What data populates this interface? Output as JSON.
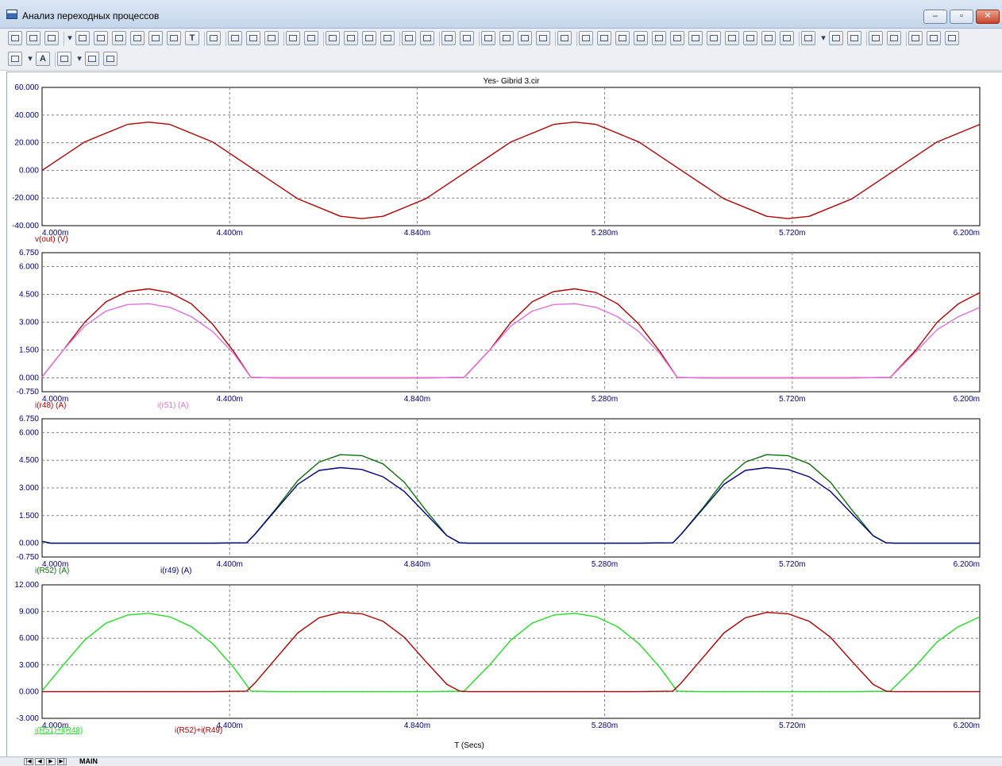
{
  "window": {
    "title": "Анализ переходных процессов",
    "minimize_label": "–",
    "restore_label": "▫",
    "close_label": "✕"
  },
  "toolbar1": {
    "text_tool_label": "T",
    "icons": [
      "select-arrow-icon",
      "pan-hand-icon",
      "scale-icon",
      "dropdown-icon",
      "zoom-window-icon",
      "scale-mode-icon",
      "cursor-mode-icon",
      "cursor-mode-2-icon",
      "data-point-icon",
      "graph-text-icon",
      "text-icon",
      "properties-icon",
      "run-icon",
      "stop-icon",
      "pause-icon",
      "scale-x-icon",
      "scale-y-icon",
      "grid-icon",
      "minor-grid-icon",
      "tokens-icon",
      "data-points-icon",
      "horizontal-axis-icon",
      "vertical-axis-icon",
      "stack-icon",
      "plot-icon",
      "zoom-out-icon",
      "zoom-in-icon",
      "zoom-fit-icon",
      "zoom-reset-icon",
      "label-branch-icon",
      "cursor-left-icon",
      "cursor-right-icon",
      "peak-icon",
      "valley-icon",
      "high-icon",
      "low-icon",
      "inflection-icon",
      "global-high-icon",
      "global-low-icon",
      "top-icon",
      "bottom-icon",
      "slope-icon",
      "copy-icon",
      "dropdown-icon",
      "list-icon",
      "numeric-output-icon",
      "stack-plots-icon",
      "fit-plots-icon",
      "zoom-plus-icon",
      "zoom-minus-icon",
      "zoom-100-icon"
    ]
  },
  "toolbar2": {
    "font_label": "A",
    "icons": [
      "grid-view-icon",
      "dropdown-icon",
      "font-icon",
      "color-icon",
      "dropdown-icon",
      "copy-plot-icon",
      "paste-plot-icon"
    ]
  },
  "plot_title": "Yes- Gibrid 3.cir",
  "x_axis_label": "T (Secs)",
  "colors": {
    "axis_text": "#000080",
    "grid": "#808080",
    "vout": "#b00000",
    "ir48": "#b00000",
    "ir51": "#e070e0",
    "iR52": "#0a6e0a",
    "ir49": "#00007f",
    "sum1": "#22dd22",
    "sum2": "#b00000"
  },
  "chart_data": [
    {
      "type": "line",
      "x_ticks": [
        "4.000m",
        "4.400m",
        "4.840m",
        "5.280m",
        "5.720m",
        "6.200m"
      ],
      "xlim": [
        4.0,
        6.2
      ],
      "x_units": "ms",
      "y_ticks": [
        "60.000",
        "40.000",
        "20.000",
        "0.000",
        "-20.000",
        "-40.000"
      ],
      "ylim": [
        -40,
        60
      ],
      "series": [
        {
          "name": "v(out) (V)",
          "x": [
            4.0,
            4.1,
            4.2,
            4.25,
            4.3,
            4.4,
            4.5,
            4.6,
            4.7,
            4.75,
            4.8,
            4.9,
            5.0,
            5.1,
            5.2,
            5.25,
            5.3,
            5.4,
            5.5,
            5.6,
            5.7,
            5.75,
            5.8,
            5.9,
            6.0,
            6.1,
            6.2
          ],
          "y": [
            0,
            20.6,
            33.2,
            34.9,
            33.2,
            20.6,
            0,
            -20.6,
            -33.2,
            -34.9,
            -33.2,
            -20.6,
            0,
            20.6,
            33.2,
            34.9,
            33.2,
            20.6,
            0,
            -20.6,
            -33.2,
            -34.9,
            -33.2,
            -20.6,
            0,
            20.6,
            33.2
          ]
        }
      ]
    },
    {
      "type": "line",
      "x_ticks": [
        "4.000m",
        "4.400m",
        "4.840m",
        "5.280m",
        "5.720m",
        "6.200m"
      ],
      "xlim": [
        4.0,
        6.2
      ],
      "y_ticks": [
        "6.750",
        "6.000",
        "4.500",
        "3.000",
        "1.500",
        "0.000",
        "-0.750"
      ],
      "ylim": [
        -0.75,
        6.75
      ],
      "series": [
        {
          "name": "i(r48) (A)",
          "x": [
            4.0,
            4.05,
            4.1,
            4.15,
            4.2,
            4.25,
            4.3,
            4.35,
            4.4,
            4.45,
            4.49,
            4.55,
            4.6,
            4.7,
            4.8,
            4.9,
            4.99,
            5.05,
            5.1,
            5.15,
            5.2,
            5.25,
            5.3,
            5.35,
            5.4,
            5.45,
            5.49,
            5.55,
            5.6,
            5.7,
            5.8,
            5.9,
            5.99,
            6.05,
            6.1,
            6.15,
            6.2
          ],
          "y": [
            0.05,
            1.5,
            3.0,
            4.1,
            4.65,
            4.8,
            4.6,
            4.0,
            2.9,
            1.4,
            0.02,
            0,
            0,
            0,
            0,
            0,
            0.02,
            1.5,
            3.0,
            4.1,
            4.65,
            4.8,
            4.6,
            4.0,
            2.9,
            1.4,
            0.02,
            0,
            0,
            0,
            0,
            0,
            0.02,
            1.5,
            3.0,
            4.0,
            4.6
          ]
        },
        {
          "name": "i(r51) (A)",
          "x": [
            4.0,
            4.05,
            4.1,
            4.15,
            4.2,
            4.25,
            4.3,
            4.35,
            4.4,
            4.45,
            4.49,
            4.55,
            4.6,
            4.7,
            4.8,
            4.9,
            4.99,
            5.05,
            5.1,
            5.15,
            5.2,
            5.25,
            5.3,
            5.35,
            5.4,
            5.45,
            5.49,
            5.55,
            5.6,
            5.7,
            5.8,
            5.9,
            5.99,
            6.05,
            6.1,
            6.15,
            6.2
          ],
          "y": [
            0.05,
            1.5,
            2.8,
            3.6,
            3.95,
            4.0,
            3.8,
            3.3,
            2.5,
            1.3,
            0.02,
            0,
            0,
            0,
            0,
            0,
            0.02,
            1.5,
            2.8,
            3.6,
            3.95,
            4.0,
            3.8,
            3.3,
            2.5,
            1.3,
            0.02,
            0,
            0,
            0,
            0,
            0,
            0.02,
            1.4,
            2.6,
            3.3,
            3.8
          ]
        }
      ]
    },
    {
      "type": "line",
      "x_ticks": [
        "4.000m",
        "4.400m",
        "4.840m",
        "5.280m",
        "5.720m",
        "6.200m"
      ],
      "xlim": [
        4.0,
        6.2
      ],
      "y_ticks": [
        "6.750",
        "6.000",
        "4.500",
        "3.000",
        "1.500",
        "0.000",
        "-0.750"
      ],
      "ylim": [
        -0.75,
        6.75
      ],
      "series": [
        {
          "name": "i(R52) (A)",
          "x": [
            4.0,
            4.02,
            4.1,
            4.2,
            4.3,
            4.4,
            4.48,
            4.5,
            4.55,
            4.6,
            4.65,
            4.7,
            4.75,
            4.8,
            4.85,
            4.9,
            4.95,
            4.98,
            5.0,
            5.1,
            5.2,
            5.3,
            5.4,
            5.48,
            5.5,
            5.55,
            5.6,
            5.65,
            5.7,
            5.75,
            5.8,
            5.85,
            5.9,
            5.95,
            5.98,
            6.0,
            6.1,
            6.2
          ],
          "y": [
            0.1,
            0,
            0,
            0,
            0,
            0,
            0.02,
            0.5,
            1.9,
            3.4,
            4.4,
            4.8,
            4.75,
            4.3,
            3.3,
            1.8,
            0.4,
            0.02,
            0,
            0,
            0,
            0,
            0,
            0.02,
            0.5,
            1.9,
            3.4,
            4.4,
            4.8,
            4.75,
            4.3,
            3.3,
            1.8,
            0.4,
            0.02,
            0,
            0,
            0
          ]
        },
        {
          "name": "i(r49) (A)",
          "x": [
            4.0,
            4.02,
            4.1,
            4.2,
            4.3,
            4.4,
            4.48,
            4.5,
            4.55,
            4.6,
            4.65,
            4.7,
            4.75,
            4.8,
            4.85,
            4.9,
            4.95,
            4.98,
            5.0,
            5.1,
            5.2,
            5.3,
            5.4,
            5.48,
            5.5,
            5.55,
            5.6,
            5.65,
            5.7,
            5.75,
            5.8,
            5.85,
            5.9,
            5.95,
            5.98,
            6.0,
            6.1,
            6.2
          ],
          "y": [
            0.1,
            0,
            0,
            0,
            0,
            0,
            0.02,
            0.5,
            1.85,
            3.2,
            3.95,
            4.1,
            4.0,
            3.6,
            2.8,
            1.6,
            0.4,
            0.02,
            0,
            0,
            0,
            0,
            0,
            0.02,
            0.5,
            1.85,
            3.2,
            3.95,
            4.1,
            4.0,
            3.6,
            2.8,
            1.6,
            0.4,
            0.02,
            0,
            0,
            0
          ]
        }
      ]
    },
    {
      "type": "line",
      "x_ticks": [
        "4.000m",
        "4.400m",
        "4.840m",
        "5.280m",
        "5.720m",
        "6.200m"
      ],
      "xlim": [
        4.0,
        6.2
      ],
      "y_ticks": [
        "12.000",
        "9.000",
        "6.000",
        "3.000",
        "0.000",
        "-3.000"
      ],
      "ylim": [
        -3,
        12
      ],
      "xlabel": "T (Secs)",
      "series": [
        {
          "name": "i(R51)+i(R48)",
          "x": [
            4.0,
            4.05,
            4.1,
            4.15,
            4.2,
            4.25,
            4.3,
            4.35,
            4.4,
            4.45,
            4.49,
            4.55,
            4.6,
            4.7,
            4.8,
            4.9,
            4.99,
            5.05,
            5.1,
            5.15,
            5.2,
            5.25,
            5.3,
            5.35,
            5.4,
            5.45,
            5.49,
            5.55,
            5.6,
            5.7,
            5.8,
            5.9,
            5.99,
            6.05,
            6.1,
            6.15,
            6.2
          ],
          "y": [
            0.1,
            3.0,
            5.8,
            7.7,
            8.6,
            8.8,
            8.4,
            7.3,
            5.4,
            2.7,
            0.05,
            0,
            0,
            0,
            0,
            0,
            0.05,
            3.0,
            5.8,
            7.7,
            8.6,
            8.8,
            8.4,
            7.3,
            5.4,
            2.7,
            0.05,
            0,
            0,
            0,
            0,
            0,
            0.05,
            2.9,
            5.6,
            7.3,
            8.4
          ]
        },
        {
          "name": "i(R52)+i(R49)",
          "x": [
            4.0,
            4.1,
            4.2,
            4.3,
            4.4,
            4.48,
            4.5,
            4.55,
            4.6,
            4.65,
            4.7,
            4.75,
            4.8,
            4.85,
            4.9,
            4.95,
            4.98,
            5.0,
            5.1,
            5.2,
            5.3,
            5.4,
            5.48,
            5.5,
            5.55,
            5.6,
            5.65,
            5.7,
            5.75,
            5.8,
            5.85,
            5.9,
            5.95,
            5.98,
            6.0,
            6.1,
            6.2
          ],
          "y": [
            0,
            0,
            0,
            0,
            0,
            0.05,
            1.0,
            3.8,
            6.6,
            8.3,
            8.9,
            8.75,
            7.9,
            6.1,
            3.4,
            0.8,
            0.05,
            0,
            0,
            0,
            0,
            0,
            0.05,
            1.0,
            3.8,
            6.6,
            8.3,
            8.9,
            8.75,
            7.9,
            6.1,
            3.4,
            0.8,
            0.05,
            0,
            0,
            0
          ]
        }
      ]
    }
  ]
}
